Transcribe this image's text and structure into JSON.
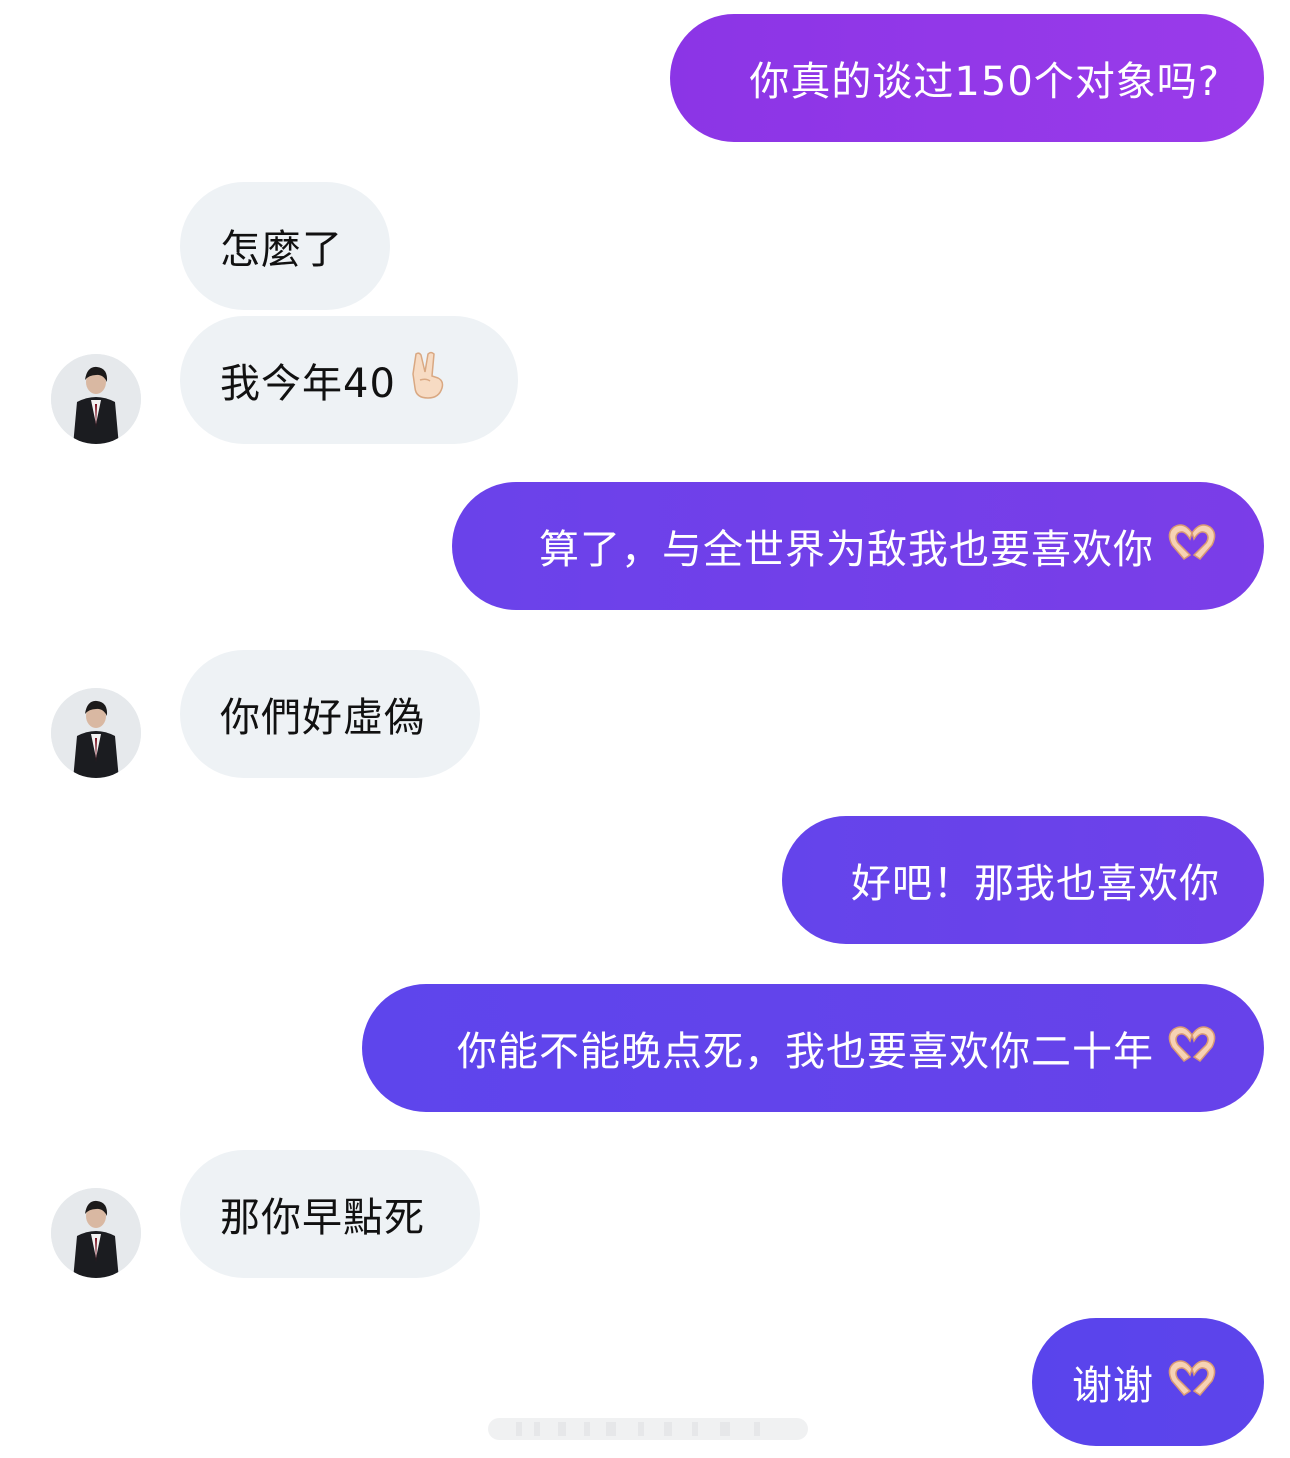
{
  "conversation": {
    "messages": [
      {
        "sender": "me",
        "text": "你真的谈过150个对象吗?",
        "emoji": ""
      },
      {
        "sender": "them",
        "text": "怎麼了",
        "emoji": ""
      },
      {
        "sender": "them",
        "text": "我今年40",
        "emoji": "victory-hand"
      },
      {
        "sender": "me",
        "text": "算了，与全世界为敌我也要喜欢你",
        "emoji": "heart-hands"
      },
      {
        "sender": "them",
        "text": "你們好虛偽",
        "emoji": ""
      },
      {
        "sender": "me",
        "text": "好吧！那我也喜欢你",
        "emoji": ""
      },
      {
        "sender": "me",
        "text": "你能不能晚点死，我也要喜欢你二十年",
        "emoji": "heart-hands"
      },
      {
        "sender": "them",
        "text": "那你早點死",
        "emoji": ""
      },
      {
        "sender": "me",
        "text": "谢谢",
        "emoji": "heart-hands"
      }
    ]
  },
  "colors": {
    "sent_gradient_top_start": "#8b35e6",
    "sent_gradient_top_end": "#9a3bea",
    "sent_gradient_bottom": "#5b44ec",
    "received_bubble": "#eef2f5",
    "received_text": "#111111",
    "sent_text": "#ffffff"
  }
}
